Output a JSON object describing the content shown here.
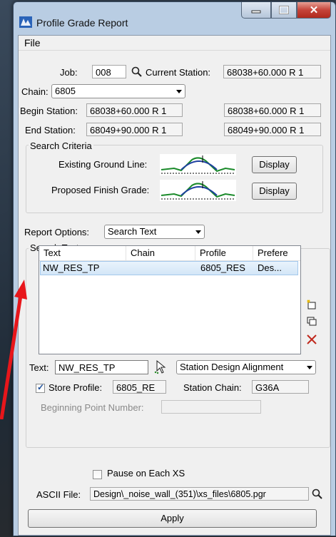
{
  "window": {
    "title": "Profile Grade Report"
  },
  "menu": {
    "file": "File"
  },
  "job": {
    "label": "Job:",
    "value": "008"
  },
  "current_station": {
    "label": "Current Station:",
    "value": "68038+60.000 R 1"
  },
  "chain": {
    "label": "Chain:",
    "value": "6805"
  },
  "begin_station": {
    "label": "Begin Station:",
    "value": "68038+60.000 R 1",
    "value2": "68038+60.000 R 1"
  },
  "end_station": {
    "label": "End Station:",
    "value": "68049+90.000 R 1",
    "value2": "68049+90.000 R 1"
  },
  "search_criteria": {
    "title": "Search Criteria",
    "existing_label": "Existing Ground Line:",
    "proposed_label": "Proposed Finish Grade:",
    "display_label": "Display"
  },
  "report_options": {
    "label": "Report Options:",
    "value": "Search Text"
  },
  "search_text": {
    "title": "Search Text",
    "columns": [
      "Text",
      "Chain",
      "Profile",
      "Prefere"
    ],
    "rows": [
      {
        "text": "NW_RES_TP",
        "chain": "",
        "profile": "6805_RES",
        "preference": "Des..."
      }
    ],
    "text_label": "Text:",
    "text_value": "NW_RES_TP",
    "alignment_value": "Station Design Alignment",
    "store_profile_label": "Store Profile:",
    "store_profile_value": "6805_RE",
    "store_profile_checked": true,
    "station_chain_label": "Station Chain:",
    "station_chain_value": "G36A",
    "beginning_point_label": "Beginning Point Number:",
    "beginning_point_value": ""
  },
  "pause": {
    "label": "Pause on Each XS",
    "checked": false
  },
  "ascii_file": {
    "label": "ASCII File:",
    "value": "Design\\_noise_wall_(351)\\xs_files\\6805.pgr"
  },
  "apply": {
    "label": "Apply"
  },
  "colors": {
    "accent": "#1c4f9c",
    "close": "#c5443a",
    "selection": "#d3e6f7",
    "annotation_arrow": "#e8161b"
  }
}
